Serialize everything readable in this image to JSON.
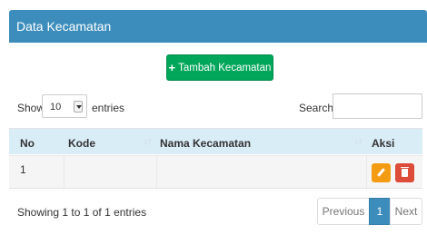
{
  "panel": {
    "title": "Data Kecamatan"
  },
  "toolbar": {
    "add_plus": "+",
    "add_label": "Tambah Kecamatan"
  },
  "length": {
    "show_label": "Show",
    "value": "10",
    "entries_label": "entries"
  },
  "search": {
    "label": "Search:",
    "placeholder": ""
  },
  "table": {
    "columns": [
      "No",
      "Kode",
      "Nama Kecamatan",
      "Aksi"
    ],
    "sort_glyph": "↓↑",
    "rows": [
      {
        "no": "1",
        "kode": "",
        "nama": ""
      }
    ]
  },
  "info": {
    "text": "Showing 1 to 1 of 1 entries"
  },
  "pagination": {
    "previous": "Previous",
    "current": "1",
    "next": "Next"
  },
  "colors": {
    "header": "#3c8dbc",
    "add": "#00a65a",
    "edit": "#f39c12",
    "delete": "#dd4b39"
  },
  "icons": {
    "edit": "pencil-icon",
    "delete": "trash-icon",
    "select_arrow": "chevron-down-icon"
  }
}
